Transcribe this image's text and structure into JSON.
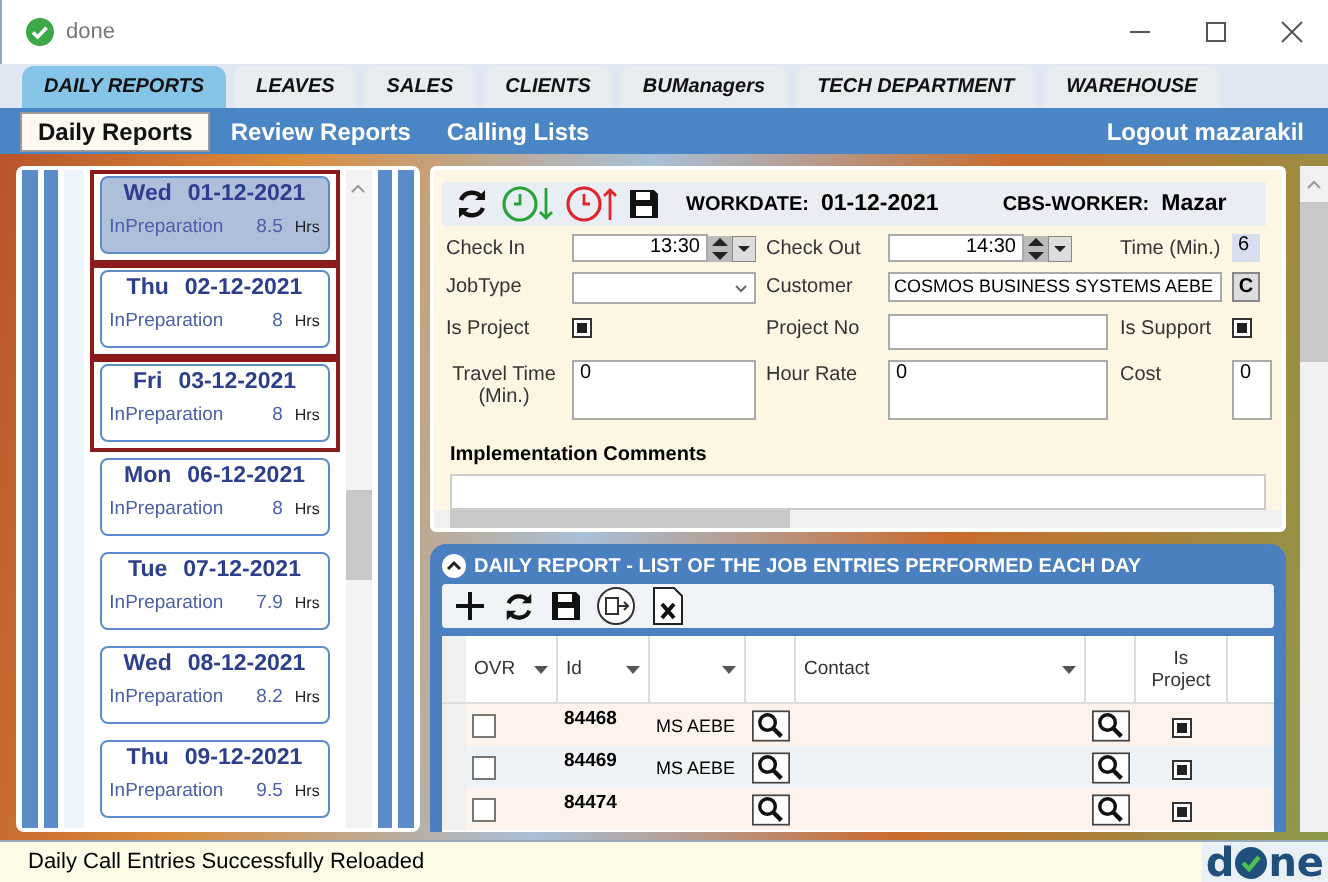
{
  "window": {
    "title": "done"
  },
  "tabs": [
    {
      "label": "DAILY REPORTS",
      "selected": true
    },
    {
      "label": "LEAVES",
      "selected": false
    },
    {
      "label": "SALES",
      "selected": false
    },
    {
      "label": "CLIENTS",
      "selected": false
    },
    {
      "label": "BUManagers",
      "selected": false
    },
    {
      "label": "TECH DEPARTMENT",
      "selected": false
    },
    {
      "label": "WAREHOUSE",
      "selected": false
    }
  ],
  "subnav": {
    "items": [
      {
        "label": "Daily Reports",
        "selected": true
      },
      {
        "label": "Review Reports",
        "selected": false
      },
      {
        "label": "Calling Lists",
        "selected": false
      }
    ],
    "logout": "Logout mazarakil"
  },
  "days": [
    {
      "weekday": "Wed",
      "date": "01-12-2021",
      "status": "InPreparation",
      "hours": "8.5",
      "unit": "Hrs",
      "selected": true,
      "flagged": true
    },
    {
      "weekday": "Thu",
      "date": "02-12-2021",
      "status": "InPreparation",
      "hours": "8",
      "unit": "Hrs",
      "selected": false,
      "flagged": true
    },
    {
      "weekday": "Fri",
      "date": "03-12-2021",
      "status": "InPreparation",
      "hours": "8",
      "unit": "Hrs",
      "selected": false,
      "flagged": true
    },
    {
      "weekday": "Mon",
      "date": "06-12-2021",
      "status": "InPreparation",
      "hours": "8",
      "unit": "Hrs",
      "selected": false,
      "flagged": false
    },
    {
      "weekday": "Tue",
      "date": "07-12-2021",
      "status": "InPreparation",
      "hours": "7.9",
      "unit": "Hrs",
      "selected": false,
      "flagged": false
    },
    {
      "weekday": "Wed",
      "date": "08-12-2021",
      "status": "InPreparation",
      "hours": "8.2",
      "unit": "Hrs",
      "selected": false,
      "flagged": false
    },
    {
      "weekday": "Thu",
      "date": "09-12-2021",
      "status": "InPreparation",
      "hours": "9.5",
      "unit": "Hrs",
      "selected": false,
      "flagged": false
    }
  ],
  "form": {
    "workdate_label": "WORKDATE:",
    "workdate": "01-12-2021",
    "worker_label": "CBS-WORKER:",
    "worker": "Mazar",
    "check_in": {
      "label": "Check In",
      "value": "13:30"
    },
    "check_out": {
      "label": "Check Out",
      "value": "14:30"
    },
    "time": {
      "label": "Time (Min.)",
      "value": "6"
    },
    "job_type": {
      "label": "JobType"
    },
    "customer": {
      "label": "Customer",
      "value": "COSMOS BUSINESS SYSTEMS AEBE",
      "button": "C"
    },
    "is_project": {
      "label": "Is Project",
      "checked": true
    },
    "project_no": {
      "label": "Project No"
    },
    "is_support": {
      "label": "Is Support",
      "checked": true
    },
    "travel_time": {
      "label": "Travel Time (Min.)",
      "value": "0"
    },
    "hour_rate": {
      "label": "Hour Rate",
      "value": "0"
    },
    "cost": {
      "label": "Cost",
      "value": "0"
    },
    "comments": {
      "label": "Implementation Comments"
    }
  },
  "jobs": {
    "title": "DAILY REPORT - LIST OF THE JOB ENTRIES PERFORMED EACH DAY",
    "columns": [
      {
        "kind": "text",
        "label": "OVR",
        "filter": true
      },
      {
        "kind": "text",
        "label": "Id",
        "filter": true
      },
      {
        "kind": "blank",
        "filter": true
      },
      {
        "kind": "button",
        "filter": false
      },
      {
        "kind": "text",
        "label": "Contact",
        "filter": true
      },
      {
        "kind": "button",
        "filter": false
      },
      {
        "kind": "text",
        "label": "Is Project",
        "filter": false
      }
    ],
    "rows": [
      {
        "ovr": false,
        "id": "84468",
        "customer": "MS AEBE",
        "is_project": true
      },
      {
        "ovr": false,
        "id": "84469",
        "customer": "MS AEBE",
        "is_project": true
      },
      {
        "ovr": false,
        "id": "84474",
        "is_project": true
      }
    ]
  },
  "status_bar": {
    "message": "Daily Call Entries Successfully Reloaded",
    "logo_left": "d",
    "logo_right": "ne"
  }
}
